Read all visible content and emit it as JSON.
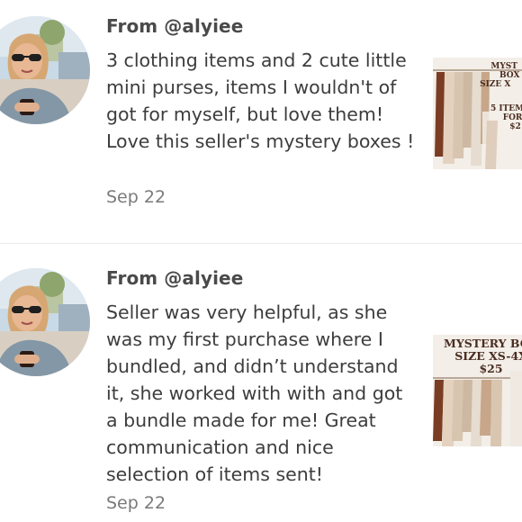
{
  "reviews": [
    {
      "from": "From @alyiee",
      "text": "3 clothing items and 2 cute little mini purses, items I wouldn't of got for myself, but love them! Love this seller's mystery boxes !",
      "date": "Sep 22",
      "thumb_lines_top": [
        "MYST",
        "BOX",
        "SIZE X"
      ],
      "thumb_lines_mid": [
        "5 ITEM",
        "FOR",
        "$2"
      ]
    },
    {
      "from": "From @alyiee",
      "text": "Seller was very helpful, as she was my first purchase where I bundled, and didn’t understand it, she worked with with and got a bundle made for me! Great communication and nice selection of items sent!",
      "date": "Sep 22",
      "thumb_lines_top": [
        "MYSTERY BOX",
        "SIZE XS-4X",
        "$25"
      ]
    }
  ],
  "colors": {
    "text": "#3d3d3d",
    "secondary_text": "#7a7a7a",
    "divider": "#ececec",
    "thumb_label": "#4a2d21"
  },
  "icons": {
    "avatar": "profile-photo-woman-sunglasses"
  }
}
